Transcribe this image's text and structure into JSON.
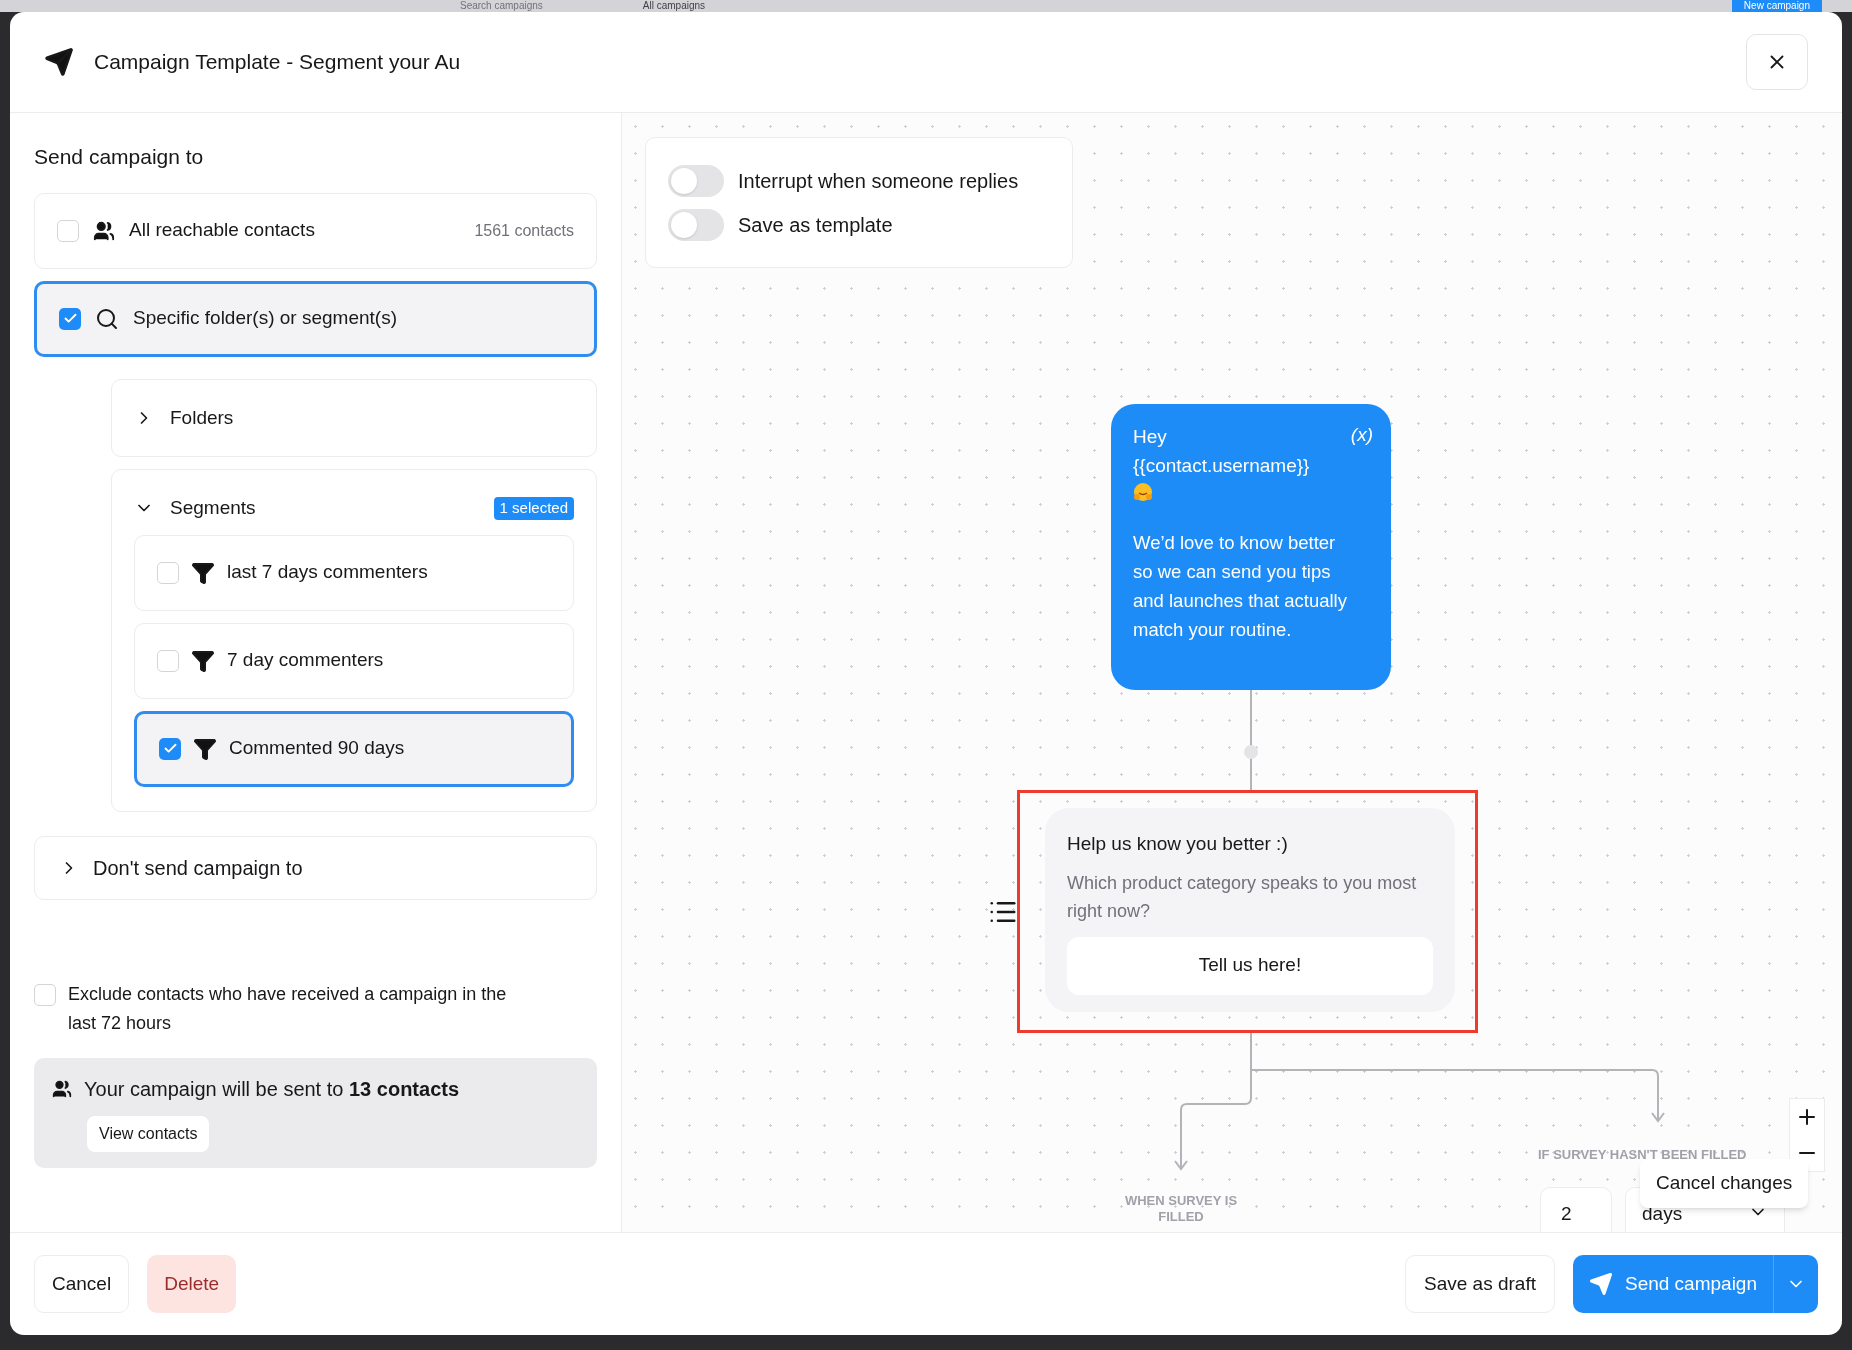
{
  "background": {
    "search_placeholder": "Search campaigns",
    "filter": "All campaigns",
    "new_button": "New campaign"
  },
  "modal": {
    "title": "Campaign Template - Segment your Au"
  },
  "audience": {
    "heading": "Send campaign to",
    "options": [
      {
        "kind": "people",
        "label": "All reachable contacts",
        "count": "1561 contacts",
        "checked": false
      },
      {
        "kind": "search",
        "label": "Specific folder(s) or segment(s)",
        "checked": true
      }
    ],
    "groups": [
      {
        "label": "Folders",
        "expanded": false
      },
      {
        "label": "Segments",
        "expanded": true,
        "badge": "1 selected",
        "items": [
          {
            "label": "last 7 days commenters",
            "checked": false
          },
          {
            "label": "7 day commenters",
            "checked": false
          },
          {
            "label": "Commented 90 days",
            "checked": true
          }
        ]
      }
    ],
    "exclude_section": {
      "label": "Don't send campaign to",
      "expanded": false
    },
    "exclude_recent": {
      "label": "Exclude contacts who have received a campaign in the last 72 hours",
      "checked": false
    },
    "summary": {
      "text": "Your campaign will be sent to **13 contacts**",
      "button": "View contacts"
    }
  },
  "settings": {
    "toggles": [
      {
        "label": "Interrupt when someone replies",
        "on": false
      },
      {
        "label": "Save as template",
        "on": false
      }
    ]
  },
  "flow": {
    "message": {
      "greeting": "Hey",
      "variable": "{{contact.username}}",
      "body": "We’d love to know better so we can send you tips and launches that actually match your routine.",
      "variable_button": "(x)"
    },
    "survey": {
      "title": "Help us know you better :)",
      "question": "Which product category speaks to you most right now?",
      "button": "Tell us here!",
      "highlighted": true
    },
    "branches": [
      {
        "label": "WHEN SURVEY IS FILLED"
      },
      {
        "label": "IF SURVEY HASN'T BEEN FILLED"
      }
    ],
    "delay": {
      "value": "2",
      "unit": "days"
    },
    "popover": "Cancel changes"
  },
  "footer": {
    "cancel": "Cancel",
    "delete": "Delete",
    "save_draft": "Save as draft",
    "send": "Send campaign"
  }
}
